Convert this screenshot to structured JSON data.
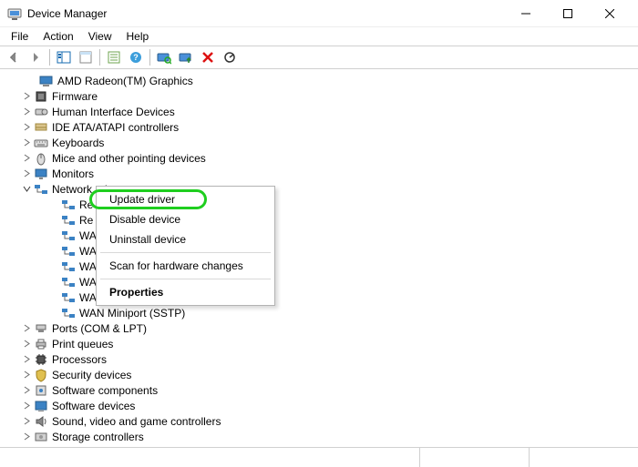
{
  "window": {
    "title": "Device Manager"
  },
  "menu": {
    "file": "File",
    "action": "Action",
    "view": "View",
    "help": "Help"
  },
  "tree": {
    "amd": "AMD Radeon(TM) Graphics",
    "firmware": "Firmware",
    "hid": "Human Interface Devices",
    "ide": "IDE ATA/ATAPI controllers",
    "keyboards": "Keyboards",
    "mice": "Mice and other pointing devices",
    "monitors": "Monitors",
    "netadapters": "Network adapters",
    "net_re1": "Re",
    "net_re2": "Re",
    "net_wa1": "WA",
    "net_wa2": "WA",
    "net_wa3": "WA",
    "net_wa4": "WA",
    "net_pptp": "WAN Miniport (PPTP)",
    "net_sstp": "WAN Miniport (SSTP)",
    "ports": "Ports (COM & LPT)",
    "printq": "Print queues",
    "processors": "Processors",
    "security": "Security devices",
    "softcomp": "Software components",
    "softdev": "Software devices",
    "sound": "Sound, video and game controllers",
    "storage": "Storage controllers"
  },
  "context_menu": {
    "update": "Update driver",
    "disable": "Disable device",
    "uninstall": "Uninstall device",
    "scan": "Scan for hardware changes",
    "properties": "Properties"
  }
}
